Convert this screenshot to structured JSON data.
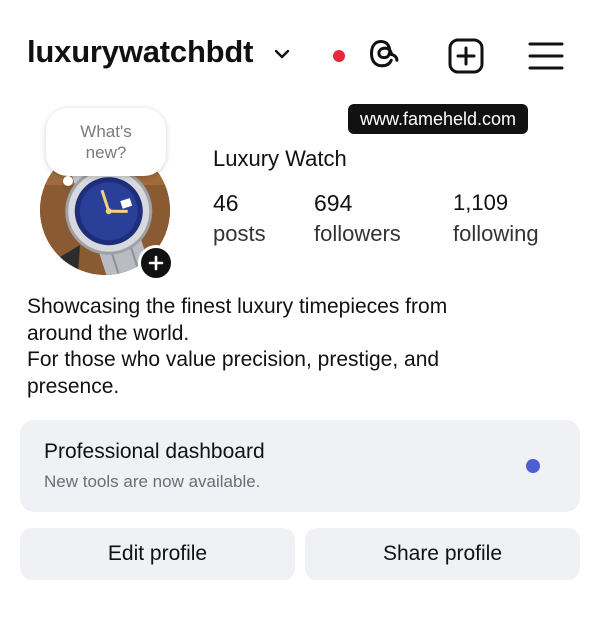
{
  "header": {
    "username": "luxurywatchbdt",
    "icons": [
      "chevron-down-icon",
      "notification-dot",
      "threads-icon",
      "add-post-icon",
      "hamburger-menu-icon"
    ],
    "colors": {
      "notification_dot": "#e8283b"
    }
  },
  "watermark": "www.fameheld.com",
  "note": {
    "text_line1": "What's",
    "text_line2": "new?"
  },
  "profile": {
    "display_name": "Luxury Watch",
    "stats": {
      "posts": {
        "value": "46",
        "label": "posts"
      },
      "followers": {
        "value": "694",
        "label": "followers"
      },
      "following": {
        "value": "1,109",
        "label": "following"
      }
    }
  },
  "bio": {
    "lines": [
      "Showcasing the finest luxury timepieces from",
      "around the world.",
      "For those who value precision, prestige, and",
      "presence."
    ]
  },
  "dashboard": {
    "title": "Professional dashboard",
    "subtitle": "New tools are now available.",
    "colors": {
      "indicator": "#4c5fd5"
    }
  },
  "buttons": {
    "edit_label": "Edit profile",
    "share_label": "Share profile"
  }
}
